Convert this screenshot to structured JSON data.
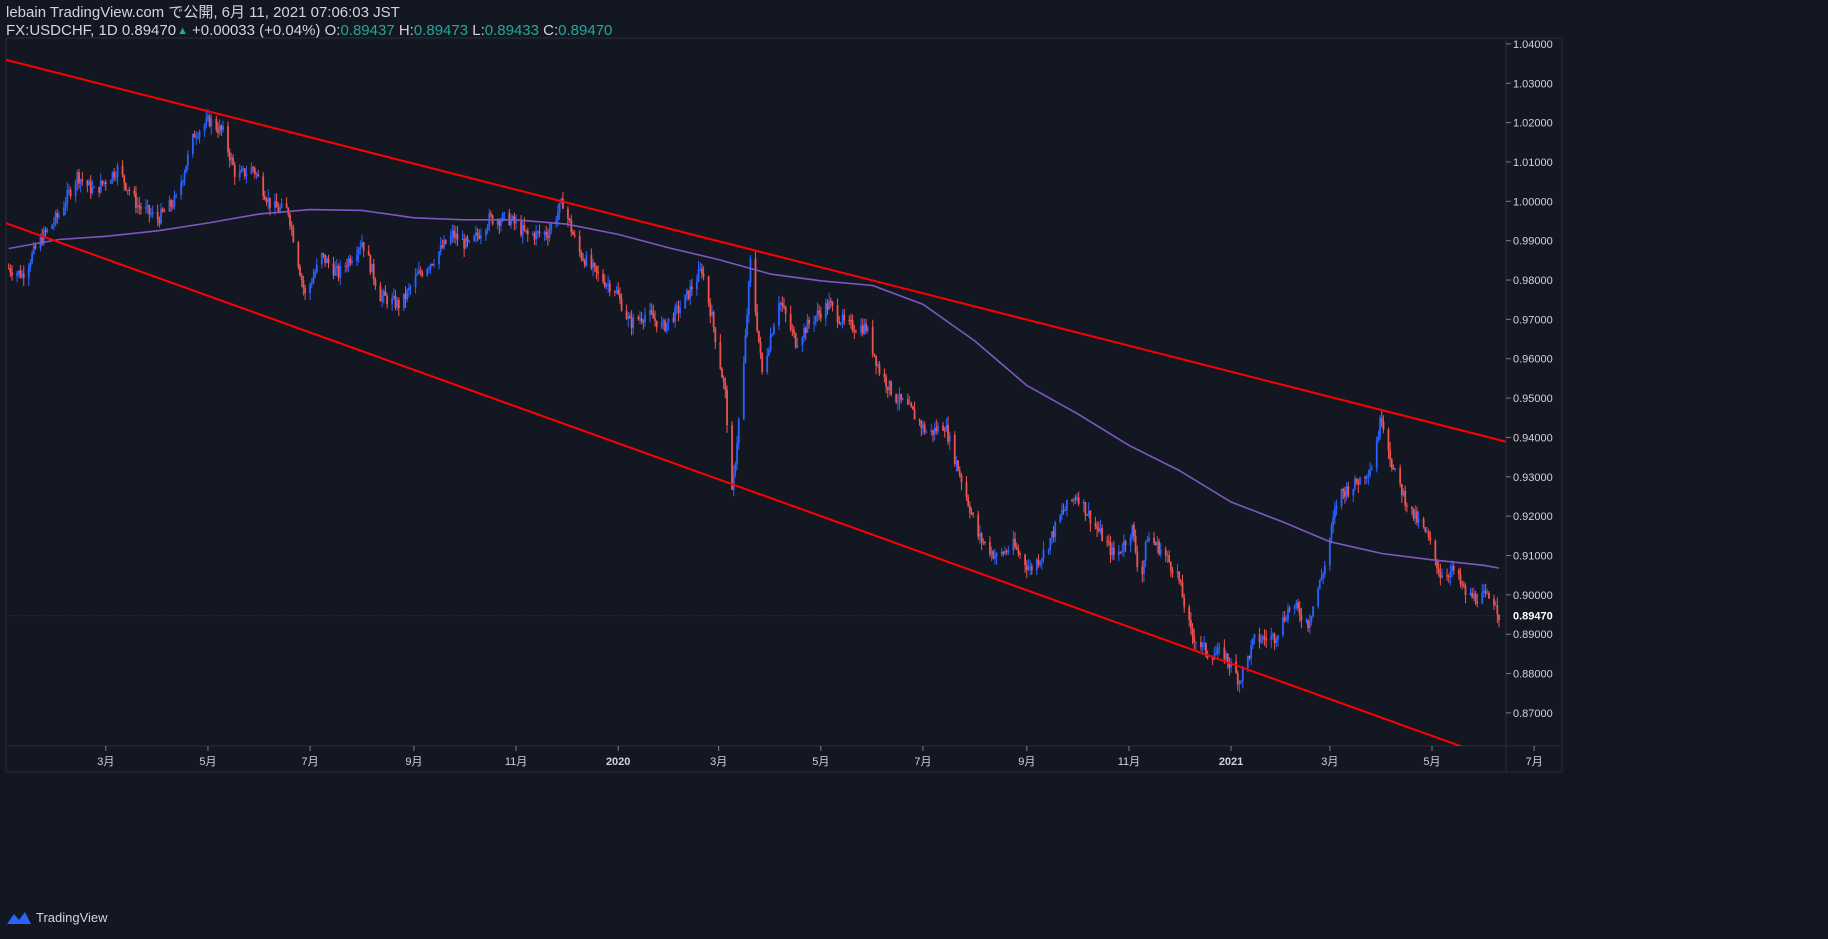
{
  "header": {
    "published": "lebain TradingView.com で公開, 6月 11, 2021 07:06:03 JST",
    "symbol": "FX:USDCHF, 1D",
    "last": "0.89470",
    "change": "+0.00033 (+0.04%)",
    "o_label": "O:",
    "o_value": "0.89437",
    "h_label": "H:",
    "h_value": "0.89473",
    "l_label": "L:",
    "l_value": "0.89433",
    "c_label": "C:",
    "c_value": "0.89470"
  },
  "footer": {
    "brand": "TradingView"
  },
  "colors": {
    "background": "#131722",
    "up": "#2962ff",
    "down": "#ef5350",
    "trendline": "#ff0000",
    "ma": "#7e57c2",
    "axis_text": "#d1d4dc",
    "grid": "#2a2e39"
  },
  "chart_data": {
    "type": "candlestick",
    "symbol": "FX:USDCHF",
    "interval": "1D",
    "ylim": [
      0.8615,
      1.0415
    ],
    "y_ticks": [
      "1.04000",
      "1.03000",
      "1.02000",
      "1.01000",
      "1.00000",
      "0.99000",
      "0.98000",
      "0.97000",
      "0.96000",
      "0.95000",
      "0.94000",
      "0.93000",
      "0.92000",
      "0.91000",
      "0.90000",
      "0.89000",
      "0.88000",
      "0.87000"
    ],
    "last_price_label": "0.89470",
    "last_price": 0.8947,
    "x_ticks": [
      {
        "date": "2019-03-01",
        "label": "3月",
        "bold": false
      },
      {
        "date": "2019-05-01",
        "label": "5月",
        "bold": false
      },
      {
        "date": "2019-07-01",
        "label": "7月",
        "bold": false
      },
      {
        "date": "2019-09-01",
        "label": "9月",
        "bold": false
      },
      {
        "date": "2019-11-01",
        "label": "11月",
        "bold": false
      },
      {
        "date": "2020-01-01",
        "label": "2020",
        "bold": true
      },
      {
        "date": "2020-03-01",
        "label": "3月",
        "bold": false
      },
      {
        "date": "2020-05-01",
        "label": "5月",
        "bold": false
      },
      {
        "date": "2020-07-01",
        "label": "7月",
        "bold": false
      },
      {
        "date": "2020-09-01",
        "label": "9月",
        "bold": false
      },
      {
        "date": "2020-11-01",
        "label": "11月",
        "bold": false
      },
      {
        "date": "2021-01-01",
        "label": "2021",
        "bold": true
      },
      {
        "date": "2021-03-01",
        "label": "3月",
        "bold": false
      },
      {
        "date": "2021-05-01",
        "label": "5月",
        "bold": false
      },
      {
        "date": "2021-07-01",
        "label": "7月",
        "bold": false
      }
    ],
    "close_path": [
      [
        "2019-01-02",
        0.983
      ],
      [
        "2019-01-10",
        0.9814
      ],
      [
        "2019-01-20",
        0.9895
      ],
      [
        "2019-02-01",
        0.9966
      ],
      [
        "2019-02-12",
        1.0066
      ],
      [
        "2019-02-22",
        1.0025
      ],
      [
        "2019-03-08",
        1.0082
      ],
      [
        "2019-03-20",
        0.999
      ],
      [
        "2019-04-01",
        0.9955
      ],
      [
        "2019-04-12",
        1.0005
      ],
      [
        "2019-04-23",
        1.0172
      ],
      [
        "2019-05-02",
        1.0205
      ],
      [
        "2019-05-10",
        1.0175
      ],
      [
        "2019-05-18",
        1.006
      ],
      [
        "2019-05-28",
        1.0085
      ],
      [
        "2019-06-08",
        0.9985
      ],
      [
        "2019-06-18",
        0.9975
      ],
      [
        "2019-06-28",
        0.976
      ],
      [
        "2019-07-08",
        0.986
      ],
      [
        "2019-07-18",
        0.9815
      ],
      [
        "2019-08-01",
        0.99
      ],
      [
        "2019-08-12",
        0.976
      ],
      [
        "2019-08-24",
        0.9735
      ],
      [
        "2019-09-03",
        0.981
      ],
      [
        "2019-09-13",
        0.9855
      ],
      [
        "2019-09-24",
        0.9915
      ],
      [
        "2019-10-04",
        0.9885
      ],
      [
        "2019-10-16",
        0.9955
      ],
      [
        "2019-10-28",
        0.9955
      ],
      [
        "2019-11-08",
        0.9913
      ],
      [
        "2019-11-20",
        0.9921
      ],
      [
        "2019-11-29",
        0.9998
      ],
      [
        "2019-12-08",
        0.9875
      ],
      [
        "2019-12-20",
        0.981
      ],
      [
        "2019-12-30",
        0.9778
      ],
      [
        "2020-01-08",
        0.969
      ],
      [
        "2020-01-18",
        0.9715
      ],
      [
        "2020-01-28",
        0.9681
      ],
      [
        "2020-02-08",
        0.9735
      ],
      [
        "2020-02-20",
        0.9828
      ],
      [
        "2020-02-26",
        0.9705
      ],
      [
        "2020-03-05",
        0.951
      ],
      [
        "2020-03-09",
        0.925
      ],
      [
        "2020-03-16",
        0.9585
      ],
      [
        "2020-03-20",
        0.9845
      ],
      [
        "2020-03-27",
        0.9563
      ],
      [
        "2020-04-06",
        0.9752
      ],
      [
        "2020-04-16",
        0.9644
      ],
      [
        "2020-04-26",
        0.9701
      ],
      [
        "2020-05-06",
        0.9738
      ],
      [
        "2020-05-16",
        0.9684
      ],
      [
        "2020-05-28",
        0.9679
      ],
      [
        "2020-06-05",
        0.9571
      ],
      [
        "2020-06-14",
        0.9505
      ],
      [
        "2020-06-24",
        0.9467
      ],
      [
        "2020-07-04",
        0.9408
      ],
      [
        "2020-07-14",
        0.9433
      ],
      [
        "2020-07-24",
        0.9294
      ],
      [
        "2020-08-03",
        0.915
      ],
      [
        "2020-08-14",
        0.9095
      ],
      [
        "2020-08-24",
        0.9125
      ],
      [
        "2020-09-03",
        0.9065
      ],
      [
        "2020-09-12",
        0.9112
      ],
      [
        "2020-09-22",
        0.9208
      ],
      [
        "2020-10-01",
        0.9255
      ],
      [
        "2020-10-12",
        0.9175
      ],
      [
        "2020-10-24",
        0.9094
      ],
      [
        "2020-11-03",
        0.9168
      ],
      [
        "2020-11-08",
        0.9028
      ],
      [
        "2020-11-12",
        0.9148
      ],
      [
        "2020-11-20",
        0.9116
      ],
      [
        "2020-11-30",
        0.9052
      ],
      [
        "2020-12-08",
        0.8902
      ],
      [
        "2020-12-18",
        0.8852
      ],
      [
        "2020-12-28",
        0.8849
      ],
      [
        "2021-01-06",
        0.8782
      ],
      [
        "2021-01-15",
        0.8885
      ],
      [
        "2021-01-27",
        0.8894
      ],
      [
        "2021-02-06",
        0.8978
      ],
      [
        "2021-02-16",
        0.8929
      ],
      [
        "2021-02-26",
        0.9074
      ],
      [
        "2021-03-06",
        0.9255
      ],
      [
        "2021-03-16",
        0.928
      ],
      [
        "2021-03-26",
        0.9329
      ],
      [
        "2021-04-01",
        0.9456
      ],
      [
        "2021-04-08",
        0.9315
      ],
      [
        "2021-04-18",
        0.9214
      ],
      [
        "2021-04-28",
        0.9151
      ],
      [
        "2021-05-06",
        0.9053
      ],
      [
        "2021-05-14",
        0.9061
      ],
      [
        "2021-05-22",
        0.8995
      ],
      [
        "2021-06-01",
        0.8994
      ],
      [
        "2021-06-08",
        0.8985
      ],
      [
        "2021-06-10",
        0.8947
      ]
    ],
    "moving_average": [
      [
        "2019-01-02",
        0.988
      ],
      [
        "2019-02-01",
        0.9903
      ],
      [
        "2019-03-01",
        0.9911
      ],
      [
        "2019-04-01",
        0.9925
      ],
      [
        "2019-05-01",
        0.9945
      ],
      [
        "2019-06-01",
        0.9968
      ],
      [
        "2019-07-01",
        0.9979
      ],
      [
        "2019-08-01",
        0.9977
      ],
      [
        "2019-09-01",
        0.9958
      ],
      [
        "2019-10-01",
        0.9953
      ],
      [
        "2019-11-01",
        0.9953
      ],
      [
        "2019-12-01",
        0.9942
      ],
      [
        "2020-01-01",
        0.9916
      ],
      [
        "2020-02-01",
        0.9881
      ],
      [
        "2020-03-01",
        0.9852
      ],
      [
        "2020-04-01",
        0.9815
      ],
      [
        "2020-05-01",
        0.9798
      ],
      [
        "2020-06-01",
        0.9786
      ],
      [
        "2020-07-01",
        0.9738
      ],
      [
        "2020-08-01",
        0.9645
      ],
      [
        "2020-09-01",
        0.9532
      ],
      [
        "2020-10-01",
        0.9461
      ],
      [
        "2020-11-01",
        0.938
      ],
      [
        "2020-12-01",
        0.9316
      ],
      [
        "2021-01-01",
        0.9236
      ],
      [
        "2021-02-01",
        0.9185
      ],
      [
        "2021-03-01",
        0.9135
      ],
      [
        "2021-04-01",
        0.9105
      ],
      [
        "2021-05-01",
        0.9089
      ],
      [
        "2021-06-01",
        0.9075
      ],
      [
        "2021-06-10",
        0.9068
      ]
    ],
    "trendlines": [
      {
        "name": "upper-channel",
        "from": [
          "2018-12-31",
          1.036
        ],
        "to": [
          "2021-07-25",
          0.9345
        ]
      },
      {
        "name": "lower-channel",
        "from": [
          "2018-12-31",
          0.9945
        ],
        "to": [
          "2021-05-25",
          0.8605
        ]
      }
    ]
  }
}
